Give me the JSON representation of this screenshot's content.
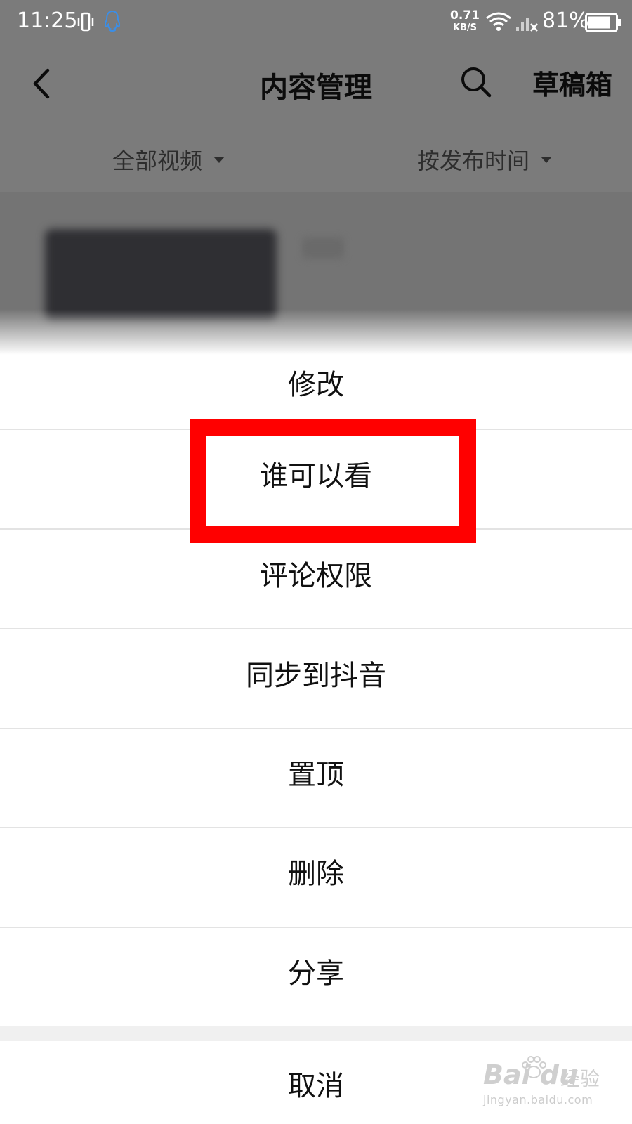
{
  "status_bar": {
    "time": "11:25",
    "net_speed_value": "0.71",
    "net_speed_unit": "KB/S",
    "battery_percent": "81%",
    "icons": [
      "vibrate-icon",
      "qq-icon",
      "wifi-icon",
      "signal-icon",
      "battery-icon"
    ],
    "battery_level": 0.81
  },
  "header": {
    "title": "内容管理",
    "drafts_label": "草稿箱",
    "back_icon": "back-icon",
    "search_icon": "search-icon"
  },
  "filters": {
    "all_videos": "全部视频",
    "sort_by": "按发布时间"
  },
  "action_sheet": {
    "items": [
      {
        "label": "修改"
      },
      {
        "label": "谁可以看",
        "highlighted": true
      },
      {
        "label": "评论权限"
      },
      {
        "label": "同步到抖音"
      },
      {
        "label": "置顶"
      },
      {
        "label": "删除"
      },
      {
        "label": "分享"
      }
    ],
    "cancel_label": "取消"
  },
  "watermark": {
    "logo": "Bai du",
    "cn": "经验",
    "url": "jingyan.baidu.com"
  },
  "colors": {
    "highlight": "#ff0000",
    "dim_overlay": "#7b7b7b",
    "qq_blue": "#3b8ee6"
  }
}
